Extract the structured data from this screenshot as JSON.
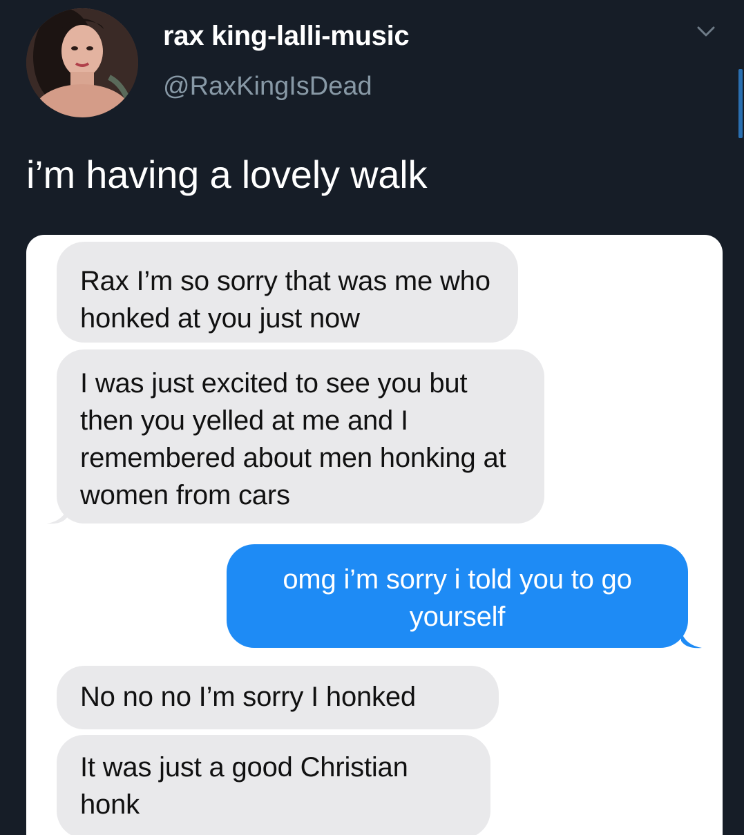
{
  "tweet": {
    "display_name": "rax king-lalli-music",
    "handle": "@RaxKingIsDead",
    "text": "i’m having a lovely walk"
  },
  "icons": {
    "more": "chevron-down-icon",
    "avatar": "avatar"
  },
  "colors": {
    "background": "#161d27",
    "incoming_bubble": "#e9e9eb",
    "outgoing_bubble": "#1e8bf5",
    "handle": "#8899a6"
  },
  "messages": [
    {
      "direction": "incoming",
      "text": "Rax I’m so sorry that was me who honked at you just now"
    },
    {
      "direction": "incoming",
      "text": "I was just excited to see you but then you yelled at me and I remembered about men honking at women from cars"
    },
    {
      "direction": "outgoing",
      "text": "omg i’m sorry i told you to go yourself"
    },
    {
      "direction": "incoming",
      "text": "No no no I’m sorry I honked"
    },
    {
      "direction": "incoming",
      "text": "It was just a good Christian honk"
    }
  ]
}
